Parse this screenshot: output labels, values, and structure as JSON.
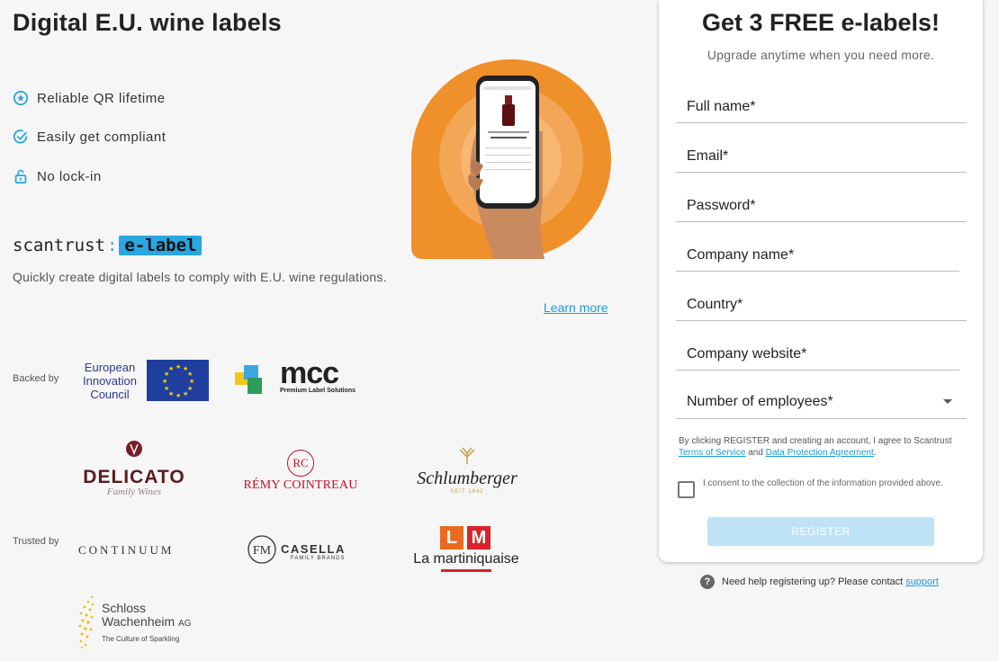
{
  "page": {
    "title": "Digital E.U. wine labels"
  },
  "features": [
    {
      "icon": "star-badge-icon",
      "label": "Reliable QR lifetime"
    },
    {
      "icon": "check-badge-icon",
      "label": "Easily get compliant"
    },
    {
      "icon": "unlock-icon",
      "label": "No lock-in"
    }
  ],
  "brand": {
    "name": "scantrust",
    "product": "e-label"
  },
  "tagline": "Quickly create digital labels to comply with E.U. wine regulations.",
  "learn_more": "Learn more",
  "backed_by": {
    "label": "Backed by",
    "eic": [
      "European",
      "Innovation",
      "Council"
    ],
    "mcc": {
      "name": "mcc",
      "sub": "Premium Label Solutions"
    }
  },
  "trusted_by": {
    "label": "Trusted by",
    "delicato": {
      "name": "DELICATO",
      "sub": "Family Wines"
    },
    "remy": {
      "monogram": "RC",
      "name": "RÉMY COINTREAU"
    },
    "schlumberger": {
      "name": "Schlumberger",
      "sub": "SEIT 1842"
    },
    "continuum": "CONTINUUM",
    "casella": {
      "name": "CASELLA",
      "sub": "FAMILY BRANDS"
    },
    "martiniquaise": {
      "l": "L",
      "m": "M",
      "name": "La martiniquaise"
    },
    "schloss": {
      "line1": "Schloss",
      "line2": "Wachenheim",
      "ag": "AG",
      "sub": "The Culture of Sparkling"
    }
  },
  "signup": {
    "title": "Get 3 FREE e-labels!",
    "subtitle": "Upgrade anytime when you need more.",
    "fields": {
      "full_name": "Full name*",
      "email": "Email*",
      "password": "Password*",
      "company": "Company name*",
      "country": "Country*",
      "website": "Company website*"
    },
    "employees": "Number of employees*",
    "terms_pre": "By clicking REGISTER and creating an account, I agree to Scantrust",
    "terms_link": "Terms of Service",
    "terms_and": "and",
    "dpa_link": "Data Protection Agreement",
    "terms_end": ".",
    "consent": "I consent to the collection of the information provided above.",
    "register": "REGISTER"
  },
  "help": {
    "text": "Need help registering up? Please contact",
    "link": "support",
    "icon": "question-icon"
  },
  "colors": {
    "accent": "#1e9ad6",
    "orange": "#f0902a",
    "register_disabled": "#bee3f6"
  }
}
